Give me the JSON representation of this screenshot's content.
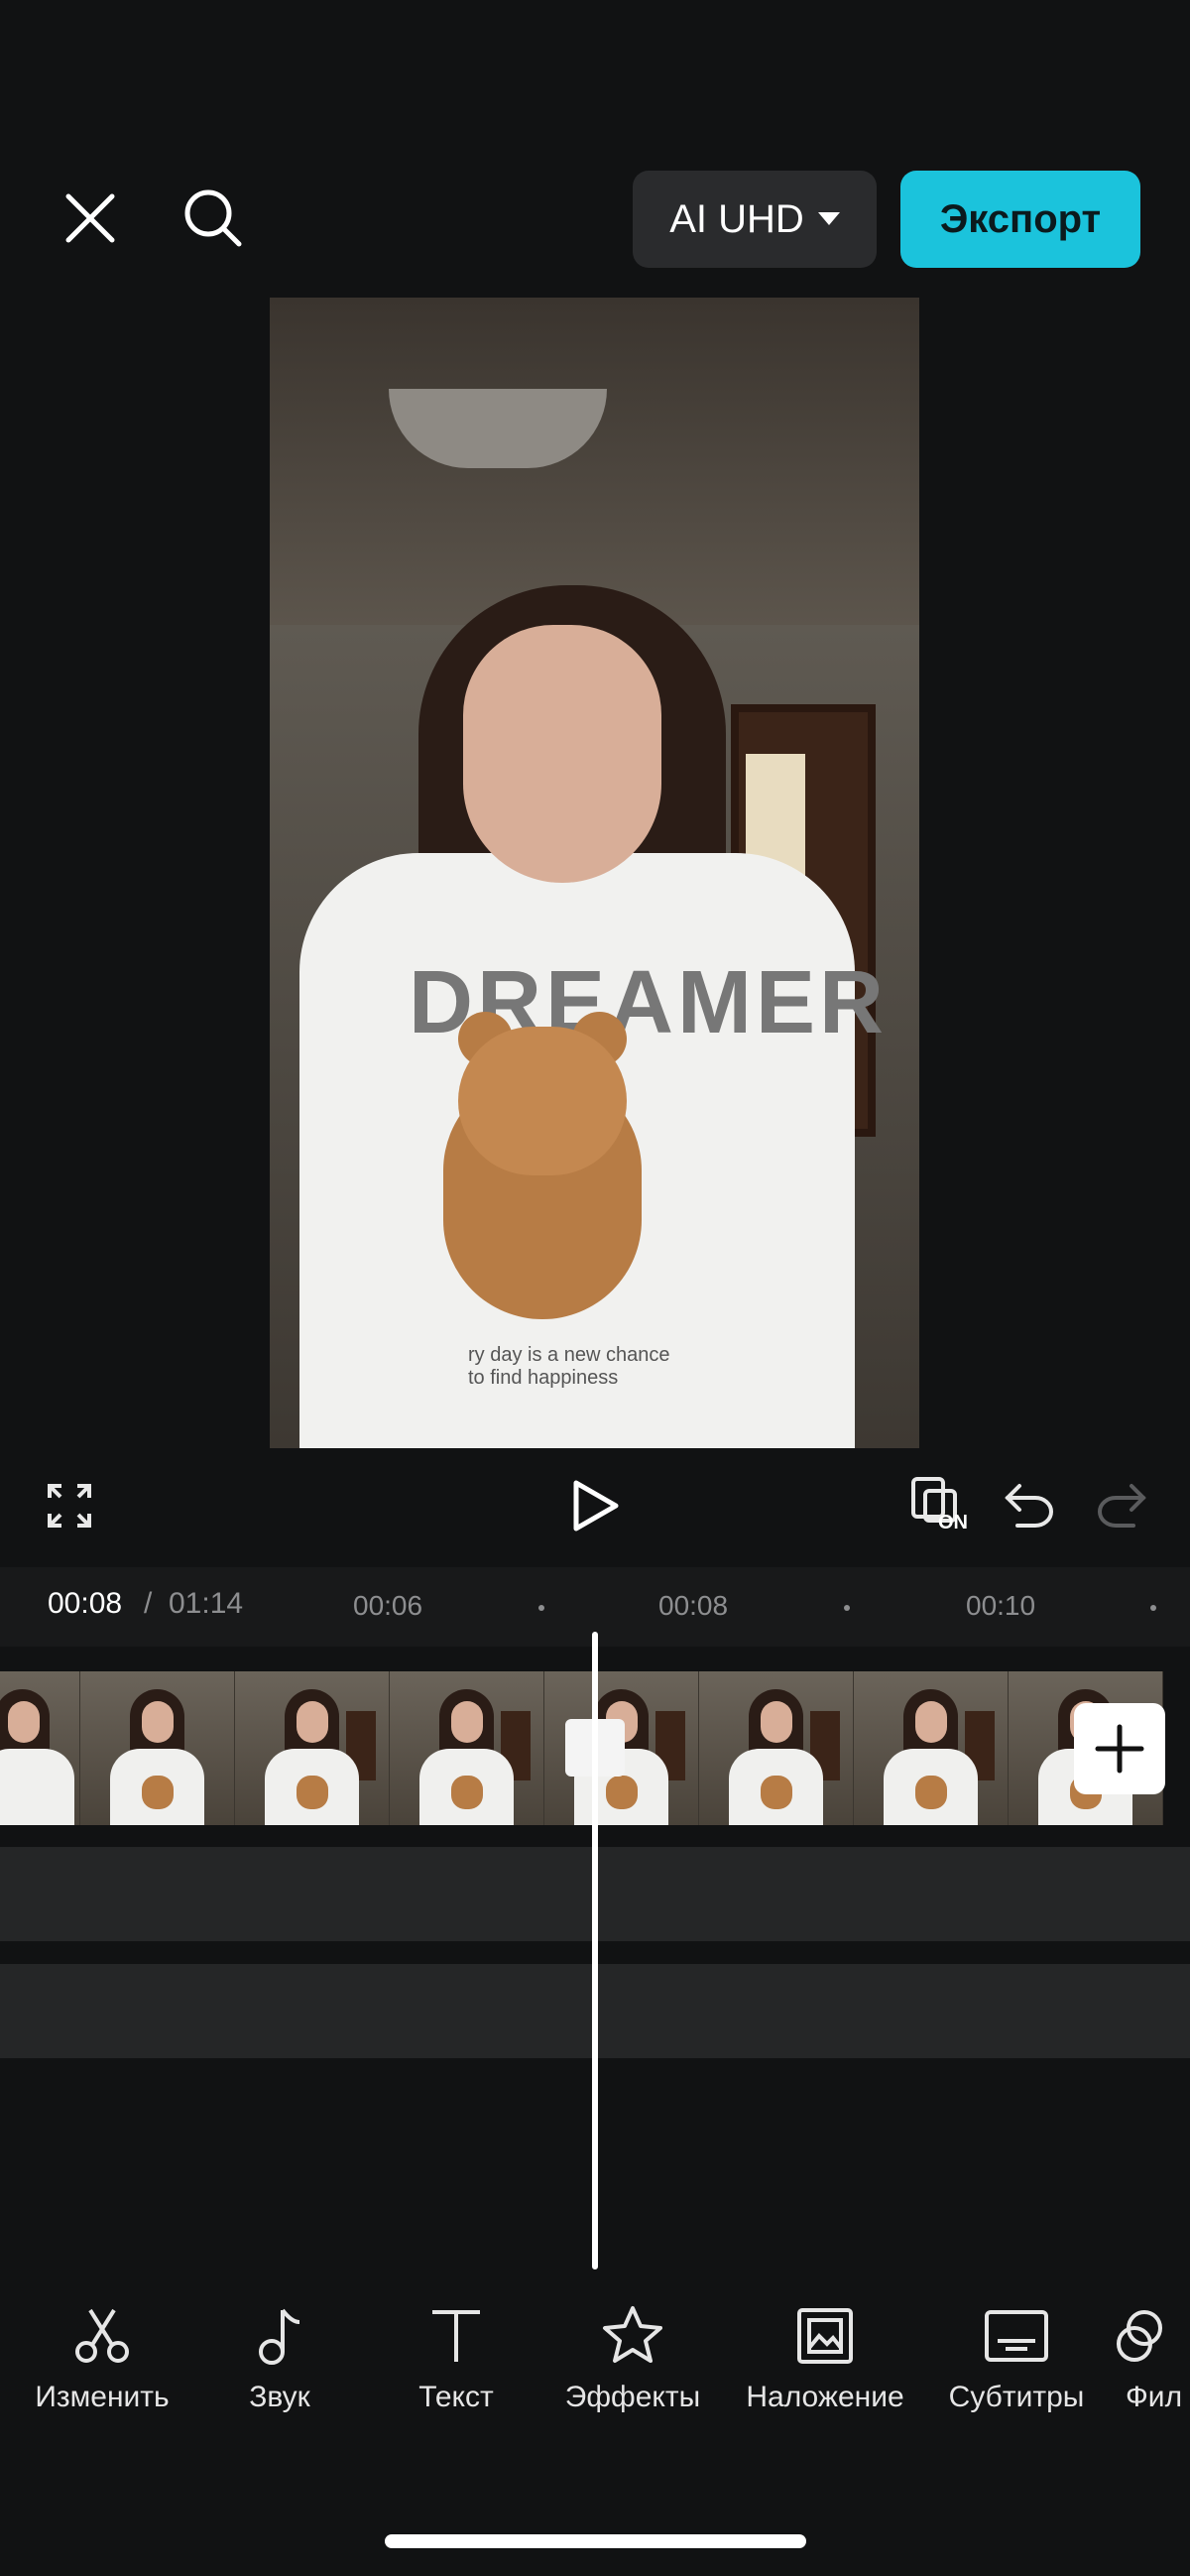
{
  "header": {
    "close_icon": "close-icon",
    "search_icon": "search-icon",
    "quality_label": "AI UHD",
    "export_label": "Экспорт",
    "accent_color": "#1bc3dc"
  },
  "preview": {
    "shirt_text": "DREAMER",
    "shirt_caption": "ry day is a new chance\nto find happiness"
  },
  "controls": {
    "fullscreen_icon": "fullscreen-icon",
    "play_icon": "play-icon",
    "keyframe_badge": "ON",
    "undo_icon": "undo-icon",
    "redo_icon": "redo-icon"
  },
  "timeline": {
    "current_time": "00:08",
    "separator": "/",
    "total_time": "01:14",
    "ticks": [
      "00:06",
      "00:08",
      "00:10"
    ]
  },
  "toolbar": {
    "items": [
      {
        "label": "Изменить",
        "icon": "scissors-icon"
      },
      {
        "label": "Звук",
        "icon": "music-note-icon"
      },
      {
        "label": "Текст",
        "icon": "text-icon"
      },
      {
        "label": "Эффекты",
        "icon": "effects-star-icon"
      },
      {
        "label": "Наложение",
        "icon": "overlay-icon"
      },
      {
        "label": "Субтитры",
        "icon": "subtitles-icon"
      },
      {
        "label": "Фил",
        "icon": "filter-icon"
      }
    ]
  }
}
